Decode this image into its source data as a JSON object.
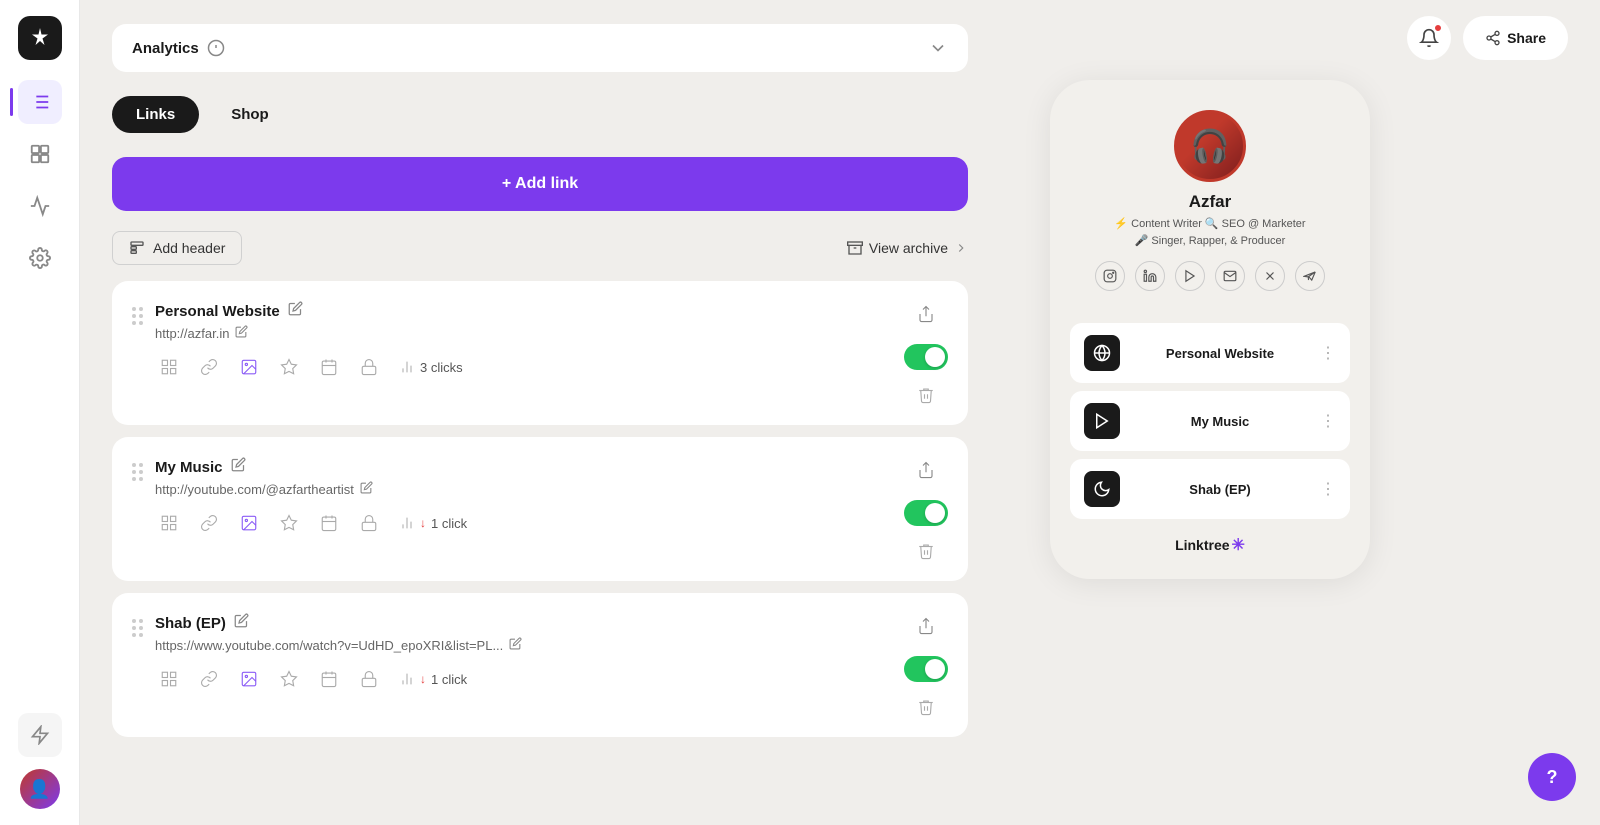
{
  "sidebar": {
    "logo_symbol": "✳",
    "nav_items": [
      {
        "id": "links",
        "label": "Links",
        "active": true
      },
      {
        "id": "pages",
        "label": "Pages"
      },
      {
        "id": "analytics",
        "label": "Analytics"
      },
      {
        "id": "settings",
        "label": "Settings"
      }
    ],
    "bottom": {
      "lightning_label": "Lightning",
      "avatar_emoji": "👤"
    }
  },
  "header": {
    "analytics_label": "Analytics",
    "share_label": "Share"
  },
  "tabs": {
    "links_label": "Links",
    "shop_label": "Shop",
    "active": "links"
  },
  "add_link_button": {
    "label": "+ Add link"
  },
  "actions": {
    "add_header_label": "Add header",
    "view_archive_label": "View archive"
  },
  "link_cards": [
    {
      "id": "personal-website",
      "title": "Personal Website",
      "url": "http://azfar.in",
      "clicks": "3 clicks",
      "enabled": true,
      "click_trend": "neutral"
    },
    {
      "id": "my-music",
      "title": "My Music",
      "url": "http://youtube.com/@azfartheartist",
      "clicks": "1 click",
      "enabled": true,
      "click_trend": "down"
    },
    {
      "id": "shab-ep",
      "title": "Shab (EP)",
      "url": "https://www.youtube.com/watch?v=UdHD_epoXRI&list=PL...",
      "clicks": "1 click",
      "enabled": true,
      "click_trend": "down"
    }
  ],
  "preview": {
    "profile": {
      "name": "Azfar",
      "bio_line1": "⚡ Content Writer 🔍 SEO @ Marketer",
      "bio_line2": "🎤 Singer, Rapper, & Producer",
      "avatar_emoji": "🎧"
    },
    "social_icons": [
      "instagram",
      "linkedin",
      "youtube",
      "email",
      "x",
      "telegram"
    ],
    "links": [
      {
        "id": "personal-website",
        "label": "Personal Website",
        "icon_type": "globe"
      },
      {
        "id": "my-music",
        "label": "My Music",
        "icon_type": "play"
      },
      {
        "id": "shab-ep",
        "label": "Shab (EP)",
        "icon_type": "moon"
      }
    ],
    "footer": "Linktree"
  },
  "help_button": {
    "label": "?"
  }
}
